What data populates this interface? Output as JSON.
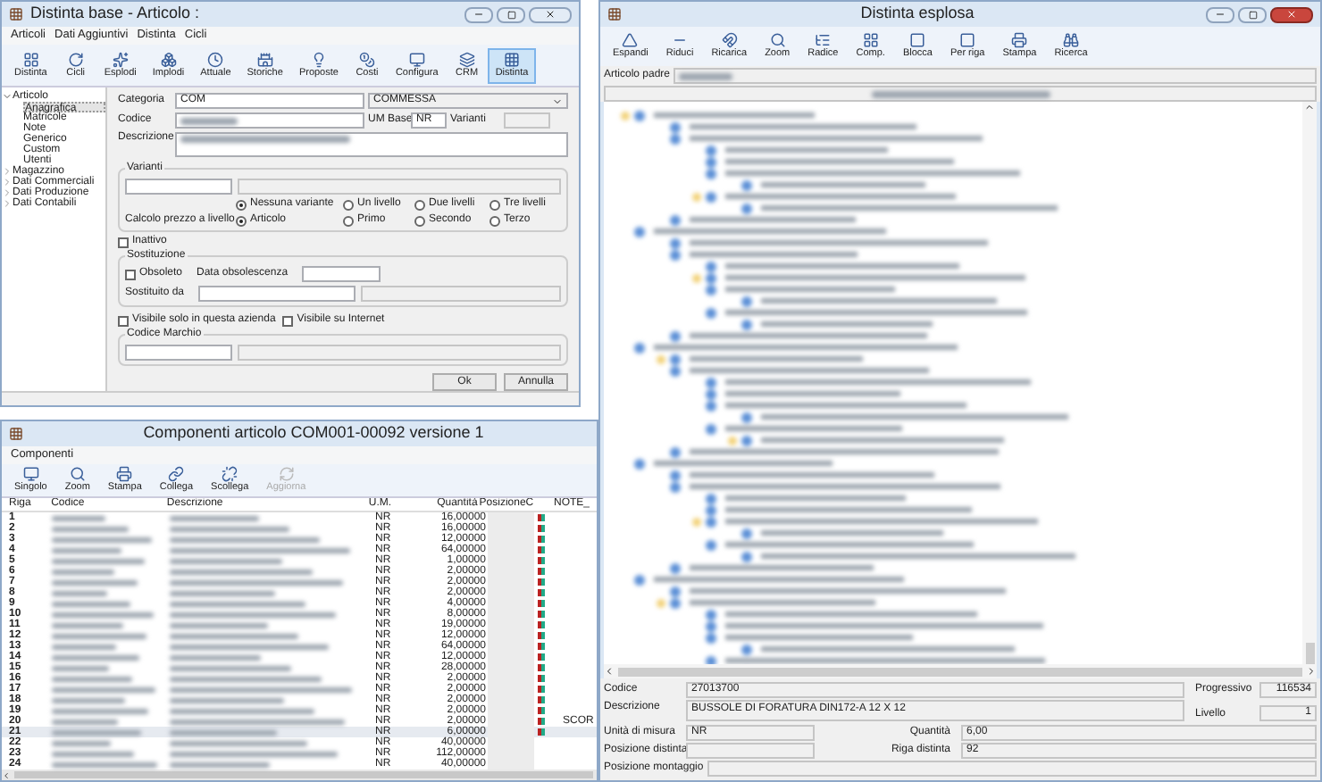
{
  "article_window": {
    "title": "Distinta base - Articolo :",
    "menu": [
      "Articoli",
      "Dati Aggiuntivi",
      "Distinta",
      "Cicli"
    ],
    "toolbar": [
      {
        "label": "Distinta",
        "selected": false
      },
      {
        "label": "Cicli",
        "selected": false
      },
      {
        "label": "Esplodi",
        "selected": false
      },
      {
        "label": "Implodi",
        "selected": false
      },
      {
        "label": "Attuale",
        "selected": false
      },
      {
        "label": "Storiche",
        "selected": false
      },
      {
        "label": "Proposte",
        "selected": false
      },
      {
        "label": "Costi",
        "selected": false
      },
      {
        "label": "Configura",
        "selected": false
      },
      {
        "label": "CRM",
        "selected": false
      },
      {
        "label": "Distinta",
        "selected": true
      }
    ],
    "tree": [
      {
        "label": "Articolo",
        "expanded": true,
        "selected": false,
        "children": [
          {
            "label": "Anagrafica",
            "selected": true
          },
          {
            "label": "Matricole",
            "selected": false
          },
          {
            "label": "Note",
            "selected": false
          },
          {
            "label": "Generico",
            "selected": false
          },
          {
            "label": "Custom",
            "selected": false
          },
          {
            "label": "Utenti",
            "selected": false
          }
        ]
      },
      {
        "label": "Magazzino",
        "expanded": false,
        "selected": false
      },
      {
        "label": "Dati Commerciali",
        "expanded": false,
        "selected": false
      },
      {
        "label": "Dati Produzione",
        "expanded": false,
        "selected": false
      },
      {
        "label": "Dati Contabili",
        "expanded": false,
        "selected": false
      }
    ],
    "form": {
      "categoria_label": "Categoria",
      "categoria_code": "COM",
      "categoria_name": "COMMESSA",
      "codice_label": "Codice",
      "um_label": "UM Base",
      "um_value": "NR",
      "varianti_label": "Varianti",
      "descrizione_label": "Descrizione",
      "varianti_group": "Varianti",
      "variant_options": [
        {
          "label": "Nessuna variante",
          "selected": true
        },
        {
          "label": "Un livello",
          "selected": false
        },
        {
          "label": "Due livelli",
          "selected": false
        },
        {
          "label": "Tre livelli",
          "selected": false
        }
      ],
      "price_label": "Calcolo prezzo a livello",
      "price_options": [
        {
          "label": "Articolo",
          "selected": true
        },
        {
          "label": "Primo",
          "selected": false
        },
        {
          "label": "Secondo",
          "selected": false
        },
        {
          "label": "Terzo",
          "selected": false
        }
      ],
      "inattivo": {
        "label": "Inattivo",
        "checked": false
      },
      "sostituzione_group": "Sostituzione",
      "obsoleto": {
        "label": "Obsoleto",
        "checked": false
      },
      "data_label": "Data obsolescenza",
      "sostituito_label": "Sostituito da",
      "visibility": [
        {
          "label": "Visibile solo in questa azienda",
          "checked": false
        },
        {
          "label": "Visibile su Internet",
          "checked": false
        }
      ],
      "marchio_group": "Codice Marchio"
    },
    "buttons": [
      "Ok",
      "Annulla"
    ]
  },
  "components_window": {
    "title": "Componenti articolo COM001-00092 versione 1",
    "menu": [
      "Componenti"
    ],
    "toolbar": [
      {
        "label": "Singolo",
        "disabled": false
      },
      {
        "label": "Zoom",
        "disabled": false
      },
      {
        "label": "Stampa",
        "disabled": false
      },
      {
        "label": "Collega",
        "disabled": false
      },
      {
        "label": "Scollega",
        "disabled": false
      },
      {
        "label": "Aggiorna",
        "disabled": true
      }
    ],
    "columns": [
      "Riga",
      "Codice",
      "Descrizione",
      "U.M.",
      "Quantità",
      "Posizione",
      "C",
      "NOTE_"
    ],
    "rows": [
      {
        "riga": "1",
        "um": "NR",
        "quantita": "16,00000",
        "marked": true,
        "selected": false
      },
      {
        "riga": "2",
        "um": "NR",
        "quantita": "16,00000",
        "marked": true,
        "selected": false
      },
      {
        "riga": "3",
        "um": "NR",
        "quantita": "12,00000",
        "marked": true,
        "selected": false
      },
      {
        "riga": "4",
        "um": "NR",
        "quantita": "64,00000",
        "marked": true,
        "selected": false
      },
      {
        "riga": "5",
        "um": "NR",
        "quantita": "1,00000",
        "marked": true,
        "selected": false
      },
      {
        "riga": "6",
        "um": "NR",
        "quantita": "2,00000",
        "marked": true,
        "selected": false
      },
      {
        "riga": "7",
        "um": "NR",
        "quantita": "2,00000",
        "marked": true,
        "selected": false
      },
      {
        "riga": "8",
        "um": "NR",
        "quantita": "2,00000",
        "marked": true,
        "selected": false
      },
      {
        "riga": "9",
        "um": "NR",
        "quantita": "4,00000",
        "marked": true,
        "selected": false
      },
      {
        "riga": "10",
        "um": "NR",
        "quantita": "8,00000",
        "marked": true,
        "selected": false
      },
      {
        "riga": "11",
        "um": "NR",
        "quantita": "19,00000",
        "marked": true,
        "selected": false
      },
      {
        "riga": "12",
        "um": "NR",
        "quantita": "12,00000",
        "marked": true,
        "selected": false
      },
      {
        "riga": "13",
        "um": "NR",
        "quantita": "64,00000",
        "marked": true,
        "selected": false
      },
      {
        "riga": "14",
        "um": "NR",
        "quantita": "12,00000",
        "marked": true,
        "selected": false
      },
      {
        "riga": "15",
        "um": "NR",
        "quantita": "28,00000",
        "marked": true,
        "selected": false
      },
      {
        "riga": "16",
        "um": "NR",
        "quantita": "2,00000",
        "marked": true,
        "selected": false
      },
      {
        "riga": "17",
        "um": "NR",
        "quantita": "2,00000",
        "marked": true,
        "selected": false
      },
      {
        "riga": "18",
        "um": "NR",
        "quantita": "2,00000",
        "marked": true,
        "selected": false
      },
      {
        "riga": "19",
        "um": "NR",
        "quantita": "2,00000",
        "marked": true,
        "selected": false
      },
      {
        "riga": "20",
        "um": "NR",
        "quantita": "2,00000",
        "marked": true,
        "selected": false,
        "note": "SCOR"
      },
      {
        "riga": "21",
        "um": "NR",
        "quantita": "6,00000",
        "marked": true,
        "selected": true
      },
      {
        "riga": "22",
        "um": "NR",
        "quantita": "40,00000",
        "marked": false,
        "selected": false
      },
      {
        "riga": "23",
        "um": "NR",
        "quantita": "112,00000",
        "marked": false,
        "selected": false
      },
      {
        "riga": "24",
        "um": "NR",
        "quantita": "40,00000",
        "marked": false,
        "selected": false
      }
    ]
  },
  "exploded_window": {
    "title": "Distinta esplosa",
    "toolbar": [
      "Espandi",
      "Riduci",
      "Ricarica",
      "Zoom",
      "Radice",
      "Comp.",
      "Blocca",
      "Per riga",
      "Stampa",
      "Ricerca"
    ],
    "articolo_padre_label": "Articolo padre",
    "details": {
      "codice_label": "Codice",
      "codice": "27013700",
      "progressivo_label": "Progressivo",
      "progressivo": "116534",
      "descrizione_label": "Descrizione",
      "descrizione": "BUSSOLE DI FORATURA DIN172-A 12 X 12",
      "livello_label": "Livello",
      "livello": "1",
      "um_label": "Unità di misura",
      "um": "NR",
      "quantita_label": "Quantità",
      "quantita": "6,00",
      "posizione_label": "Posizione distinta",
      "riga_label": "Riga distinta",
      "riga": "92",
      "montaggio_label": "Posizione montaggio"
    }
  }
}
